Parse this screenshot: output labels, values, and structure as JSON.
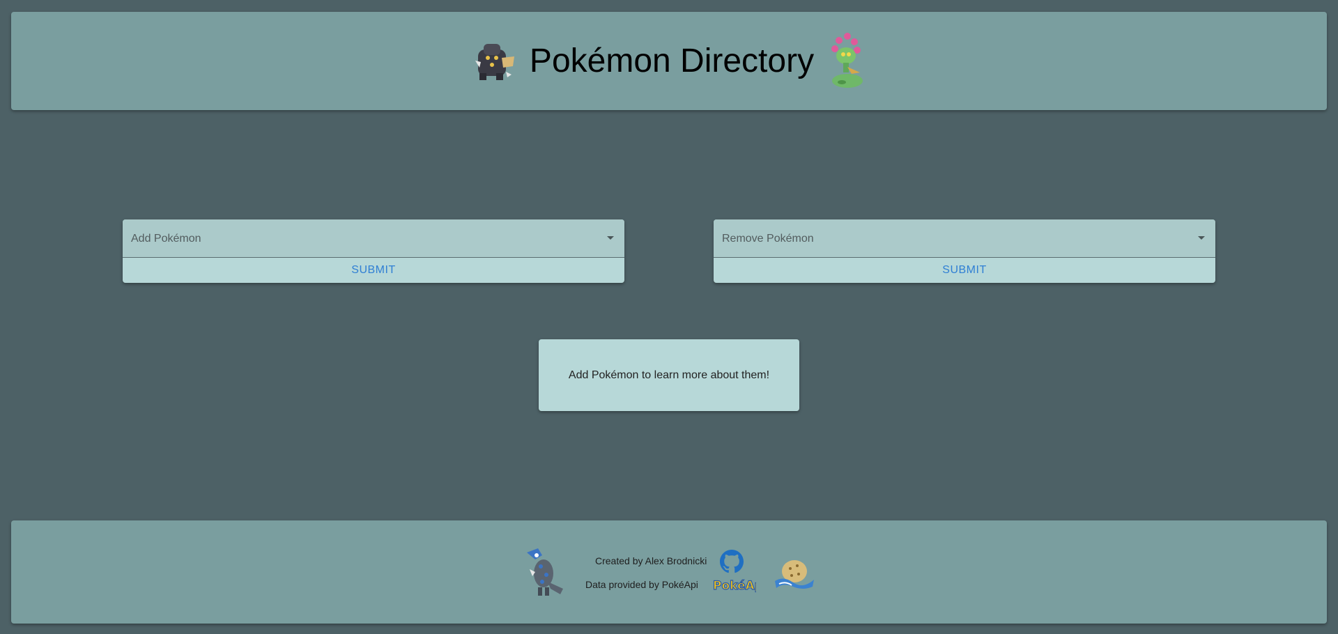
{
  "header": {
    "title": "Pokémon Directory",
    "left_sprite": "dark-rock-pokemon-sprite",
    "right_sprite": "green-plant-pokemon-sprite"
  },
  "add_card": {
    "placeholder": "Add Pokémon",
    "submit_label": "SUBMIT"
  },
  "remove_card": {
    "placeholder": "Remove Pokémon",
    "submit_label": "SUBMIT"
  },
  "info": {
    "message": "Add Pokémon to learn more about them!"
  },
  "footer": {
    "created_by": "Created by Alex Brodnicki",
    "data_provided": "Data provided by PokéApi",
    "github_icon": "github-icon",
    "pokeapi_logo": "PokéApi",
    "left_sprite": "blue-dragon-pokemon-sprite",
    "right_sprite": "shell-pokemon-sprite"
  },
  "colors": {
    "background": "#4d6166",
    "panel": "#7a9e9f",
    "card": "#b7d8d8",
    "select_field": "#abcaca",
    "button_text": "#2f7fd4"
  }
}
